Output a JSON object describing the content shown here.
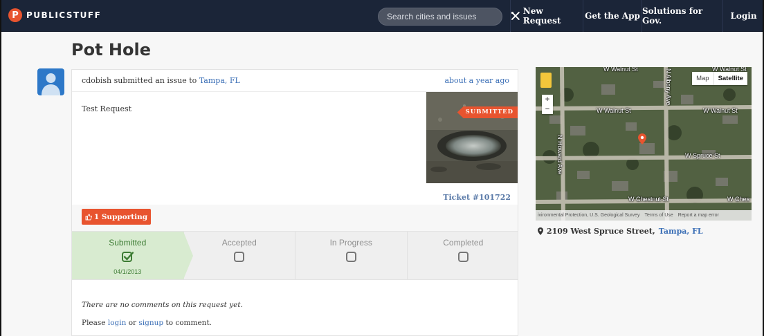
{
  "brand": {
    "logo_letter": "P",
    "name": "PUBLICSTUFF"
  },
  "search": {
    "placeholder": "Search cities and issues"
  },
  "nav": {
    "new_request": "New Request",
    "get_app": "Get the App",
    "solutions": "Solutions for Gov.",
    "login": "Login"
  },
  "issue": {
    "title": "Pot Hole",
    "submitter_text": "cdobish submitted an issue to",
    "location_link": "Tampa, FL",
    "time_ago": "about a year ago",
    "description": "Test Request",
    "status_badge": "SUBMITTED",
    "ticket": "Ticket #101722",
    "support_label": "1 Supporting"
  },
  "steps": [
    {
      "label": "Submitted",
      "date": "04/1/2013",
      "state": "done"
    },
    {
      "label": "Accepted",
      "state": "pending"
    },
    {
      "label": "In Progress",
      "state": "pending"
    },
    {
      "label": "Completed",
      "state": "pending"
    }
  ],
  "comments": {
    "empty_text": "There are no comments on this request yet.",
    "prompt_prefix": "Please",
    "login": "login",
    "or": "or",
    "signup": "signup",
    "prompt_suffix": "to comment."
  },
  "map": {
    "type_map": "Map",
    "type_satellite": "Satellite",
    "zoom_in": "+",
    "zoom_out": "−",
    "streets": {
      "top_left": "W Walnut St",
      "top_right": "W Walnut St",
      "albany": "N Albany Ave",
      "spruce": "W Spruce St",
      "howard": "N Howard Ave",
      "chestnut_mid": "W Chestnut St",
      "chestnut_right": "W Ches",
      "top_cut": "W Walnut St",
      "top_right_cut": "W Walnut St"
    },
    "footer": {
      "attribution": "ivironmental Protection, U.S. Geological Survey",
      "terms": "Terms of Use",
      "report": "Report a map error"
    }
  },
  "address": {
    "street": "2109 West Spruce Street,",
    "city": "Tampa, FL"
  },
  "colors": {
    "navbar": "#1b2538",
    "accent": "#e8542f",
    "link": "#3b6fb6",
    "step_done_bg": "#d8ebd0",
    "step_done_text": "#3d7c34"
  }
}
